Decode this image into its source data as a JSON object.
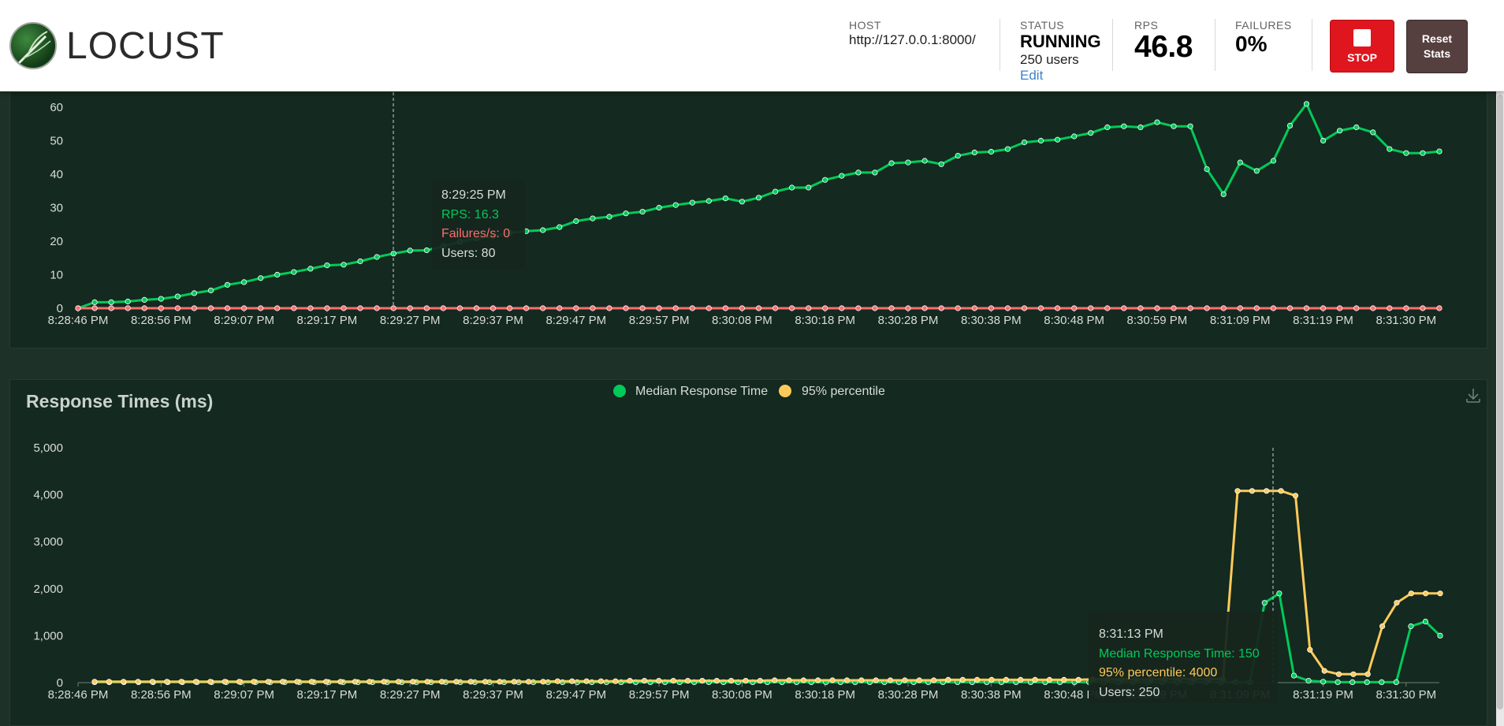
{
  "header": {
    "logo_text": "LOCUST",
    "host_label": "HOST",
    "host_value": "http://127.0.0.1:8000/",
    "status_label": "STATUS",
    "status_value": "RUNNING",
    "users_value": "250 users",
    "edit_label": "Edit",
    "rps_label": "RPS",
    "rps_value": "46.8",
    "failures_label": "FAILURES",
    "failures_value": "0%",
    "stop_label": "STOP",
    "reset_label_1": "Reset",
    "reset_label_2": "Stats"
  },
  "colors": {
    "rps": "#00ca5a",
    "failures": "#ff6d6d",
    "median": "#00ca5a",
    "p95": "#ffca5a",
    "panel_bg": "#14291f",
    "page_bg": "#1e3128"
  },
  "chart_data": [
    {
      "type": "line",
      "title": "",
      "x_ticks": [
        "8:28:46 PM",
        "8:28:56 PM",
        "8:29:07 PM",
        "8:29:17 PM",
        "8:29:27 PM",
        "8:29:37 PM",
        "8:29:47 PM",
        "8:29:57 PM",
        "8:30:08 PM",
        "8:30:18 PM",
        "8:30:28 PM",
        "8:30:38 PM",
        "8:30:48 PM",
        "8:30:59 PM",
        "8:31:09 PM",
        "8:31:19 PM",
        "8:31:30 PM"
      ],
      "y_ticks": [
        "0",
        "10",
        "20",
        "30",
        "40",
        "50",
        "60"
      ],
      "ylim": [
        0,
        65
      ],
      "series": [
        {
          "name": "RPS",
          "values": [
            0,
            1.8,
            1.8,
            2.0,
            2.5,
            2.8,
            3.5,
            4.5,
            5.3,
            7.0,
            7.8,
            9.0,
            10.0,
            10.8,
            11.8,
            12.8,
            13.0,
            14.0,
            15.3,
            16.3,
            17.2,
            17.3,
            18.5,
            19.8,
            20.8,
            21.5,
            22.5,
            23.0,
            23.3,
            24.2,
            26.0,
            26.8,
            27.3,
            28.3,
            28.8,
            30.0,
            30.8,
            31.5,
            32.0,
            32.8,
            31.8,
            33.0,
            34.8,
            36.0,
            36.0,
            38.3,
            39.5,
            40.5,
            40.5,
            43.3,
            43.5,
            44.0,
            43.0,
            45.5,
            46.5,
            46.7,
            47.5,
            49.5,
            50.0,
            50.3,
            51.3,
            52.3,
            54.0,
            54.3,
            54.0,
            55.5,
            54.3,
            54.3,
            41.5,
            34.0,
            43.5,
            41.0,
            44.0,
            54.5,
            61.0,
            50.0,
            53.0,
            54.0,
            52.5,
            47.5,
            46.3,
            46.3,
            46.8
          ]
        },
        {
          "name": "Failures/s",
          "values": [
            0,
            0,
            0,
            0,
            0,
            0,
            0,
            0,
            0,
            0,
            0,
            0,
            0,
            0,
            0,
            0,
            0,
            0,
            0,
            0,
            0,
            0,
            0,
            0,
            0,
            0,
            0,
            0,
            0,
            0,
            0,
            0,
            0,
            0,
            0,
            0,
            0,
            0,
            0,
            0,
            0,
            0,
            0,
            0,
            0,
            0,
            0,
            0,
            0,
            0,
            0,
            0,
            0,
            0,
            0,
            0,
            0,
            0,
            0,
            0,
            0,
            0,
            0,
            0,
            0,
            0,
            0,
            0,
            0,
            0,
            0,
            0,
            0,
            0,
            0,
            0,
            0,
            0,
            0,
            0,
            0,
            0,
            0
          ]
        }
      ],
      "tooltip": {
        "time": "8:29:25 PM",
        "rps": "RPS: 16.3",
        "failures": "Failures/s: 0",
        "users": "Users: 80"
      }
    },
    {
      "type": "line",
      "title": "Response Times (ms)",
      "legend": [
        "Median Response Time",
        "95% percentile"
      ],
      "x_ticks": [
        "8:28:46 PM",
        "8:28:56 PM",
        "8:29:07 PM",
        "8:29:17 PM",
        "8:29:27 PM",
        "8:29:37 PM",
        "8:29:47 PM",
        "8:29:57 PM",
        "8:30:08 PM",
        "8:30:18 PM",
        "8:30:28 PM",
        "8:30:38 PM",
        "8:30:48 PM",
        "8:30:59 PM",
        "8:31:09 PM",
        "8:31:19 PM",
        "8:31:30 PM"
      ],
      "y_ticks": [
        "0",
        "1,000",
        "2,000",
        "3,000",
        "4,000",
        "5,000"
      ],
      "ylim": [
        0,
        5000
      ],
      "series": [
        {
          "name": "Median Response Time",
          "values": [
            10,
            10,
            10,
            10,
            10,
            10,
            10,
            10,
            10,
            10,
            10,
            10,
            10,
            10,
            10,
            10,
            10,
            10,
            10,
            10,
            10,
            10,
            10,
            10,
            10,
            10,
            10,
            10,
            10,
            10,
            10,
            10,
            10,
            10,
            10,
            10,
            10,
            10,
            10,
            10,
            10,
            10,
            10,
            10,
            10,
            10,
            10,
            10,
            10,
            10,
            10,
            10,
            10,
            10,
            10,
            10,
            10,
            10,
            10,
            10,
            10,
            10,
            10,
            10,
            10,
            10,
            10,
            10,
            10,
            10,
            10,
            10,
            10,
            10,
            10,
            10,
            10,
            10,
            10,
            10,
            1700,
            1900,
            150,
            40,
            20,
            10,
            10,
            10,
            10,
            10,
            1200,
            1300,
            1000
          ]
        },
        {
          "name": "95% percentile",
          "values": [
            20,
            20,
            20,
            20,
            20,
            20,
            20,
            20,
            20,
            20,
            20,
            20,
            20,
            20,
            20,
            20,
            20,
            20,
            20,
            20,
            20,
            20,
            20,
            20,
            20,
            20,
            20,
            20,
            20,
            20,
            20,
            20,
            30,
            30,
            30,
            30,
            30,
            40,
            40,
            40,
            40,
            40,
            40,
            40,
            40,
            40,
            40,
            50,
            50,
            50,
            50,
            50,
            50,
            50,
            50,
            50,
            50,
            50,
            50,
            60,
            60,
            60,
            60,
            60,
            60,
            60,
            60,
            60,
            60,
            70,
            70,
            70,
            70,
            70,
            80,
            80,
            80,
            80,
            80,
            4080,
            4080,
            4080,
            4080,
            3980,
            700,
            250,
            180,
            180,
            180,
            1200,
            1700,
            1900,
            1900,
            1900
          ]
        }
      ],
      "tooltip": {
        "time": "8:31:13 PM",
        "median": "Median Response Time: 150",
        "p95": "95% percentile: 4000",
        "users": "Users: 250"
      }
    }
  ]
}
